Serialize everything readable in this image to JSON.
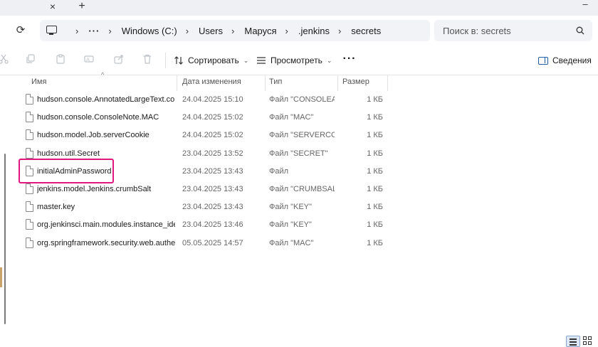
{
  "titlebar": {
    "tab_close_glyph": "×",
    "new_tab_glyph": "+",
    "window_close_glyph": "–"
  },
  "navbar": {
    "refresh_glyph": "⟳",
    "breadcrumbs": [
      "Windows (C:)",
      "Users",
      "Маруся",
      ".jenkins",
      "secrets"
    ],
    "overflow_label": "···",
    "separator": "›",
    "search_placeholder": "Поиск в: secrets"
  },
  "toolbar": {
    "sort_label": "Сортировать",
    "view_label": "Просмотреть",
    "more_label": "···",
    "details_label": "Сведения",
    "icons": [
      "cut-icon",
      "copy-icon",
      "paste-icon",
      "rename-icon",
      "share-icon",
      "delete-icon"
    ]
  },
  "columns": {
    "name": "Имя",
    "date": "Дата изменения",
    "type": "Тип",
    "size": "Размер"
  },
  "files": [
    {
      "name": "hudson.console.AnnotatedLargeText.consoleAnnotator",
      "date": "24.04.2025 15:10",
      "type": "Файл \"CONSOLEANNOTATOR\"",
      "size": "1 КБ"
    },
    {
      "name": "hudson.console.ConsoleNote.MAC",
      "date": "24.04.2025 15:02",
      "type": "Файл \"MAC\"",
      "size": "1 КБ"
    },
    {
      "name": "hudson.model.Job.serverCookie",
      "date": "24.04.2025 15:02",
      "type": "Файл \"SERVERCOOKIE\"",
      "size": "1 КБ"
    },
    {
      "name": "hudson.util.Secret",
      "date": "23.04.2025 13:52",
      "type": "Файл \"SECRET\"",
      "size": "1 КБ"
    },
    {
      "name": "initialAdminPassword",
      "date": "23.04.2025 13:43",
      "type": "Файл",
      "size": "1 КБ"
    },
    {
      "name": "jenkins.model.Jenkins.crumbSalt",
      "date": "23.04.2025 13:43",
      "type": "Файл \"CRUMBSALT\"",
      "size": "1 КБ"
    },
    {
      "name": "master.key",
      "date": "23.04.2025 13:43",
      "type": "Файл \"KEY\"",
      "size": "1 КБ"
    },
    {
      "name": "org.jenkinsci.main.modules.instance_identity.InstanceIdentity.KEY",
      "date": "23.04.2025 13:46",
      "type": "Файл \"KEY\"",
      "size": "1 КБ"
    },
    {
      "name": "org.springframework.security.web.authentication.rememberme.TokenBasedRememberMeServices.mac",
      "date": "05.05.2025 14:57",
      "type": "Файл \"MAC\"",
      "size": "1 КБ"
    }
  ],
  "highlighted_file": "initialAdminPassword",
  "colors": {
    "highlight": "#e0187f",
    "accent": "#1f5fa8",
    "toolbar_disabled": "#bfc3c8"
  }
}
